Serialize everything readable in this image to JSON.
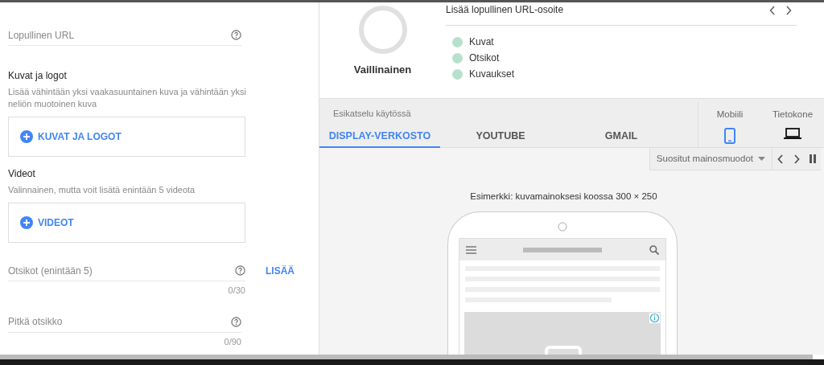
{
  "form": {
    "final_url": {
      "placeholder": "Lopullinen URL"
    },
    "images": {
      "title": "Kuvat ja logot",
      "hint": "Lisää vähintään yksi vaakasuuntainen kuva ja vähintään yksi neliön muotoinen kuva",
      "button": "KUVAT JA LOGOT"
    },
    "videos": {
      "title": "Videot",
      "hint": "Valinnainen, mutta voit lisätä enintään 5 videota",
      "button": "VIDEOT"
    },
    "headlines": {
      "placeholder": "Otsikot (enintään 5)",
      "counter": "0/30",
      "add": "LISÄÄ"
    },
    "long_headline": {
      "placeholder": "Pitkä otsikko",
      "counter": "0/90"
    }
  },
  "status": {
    "label": "Vaillinainen",
    "message": "Lisää lopullinen URL-osoite",
    "checklist": [
      {
        "label": "Kuvat"
      },
      {
        "label": "Otsikot"
      },
      {
        "label": "Kuvaukset"
      }
    ]
  },
  "preview": {
    "caption": "Esikatselu käytössä",
    "tabs": [
      {
        "label": "DISPLAY-VERKOSTO",
        "selected": true
      },
      {
        "label": "YOUTUBE",
        "selected": false
      },
      {
        "label": "GMAIL",
        "selected": false
      }
    ],
    "devices": [
      {
        "label": "Mobiili",
        "kind": "phone",
        "selected": true
      },
      {
        "label": "Tietokone",
        "kind": "laptop",
        "selected": false
      }
    ],
    "format_dropdown": "Suositut mainosmuodot",
    "example": "Esimerkki: kuvamainoksesi koossa 300 × 250"
  }
}
